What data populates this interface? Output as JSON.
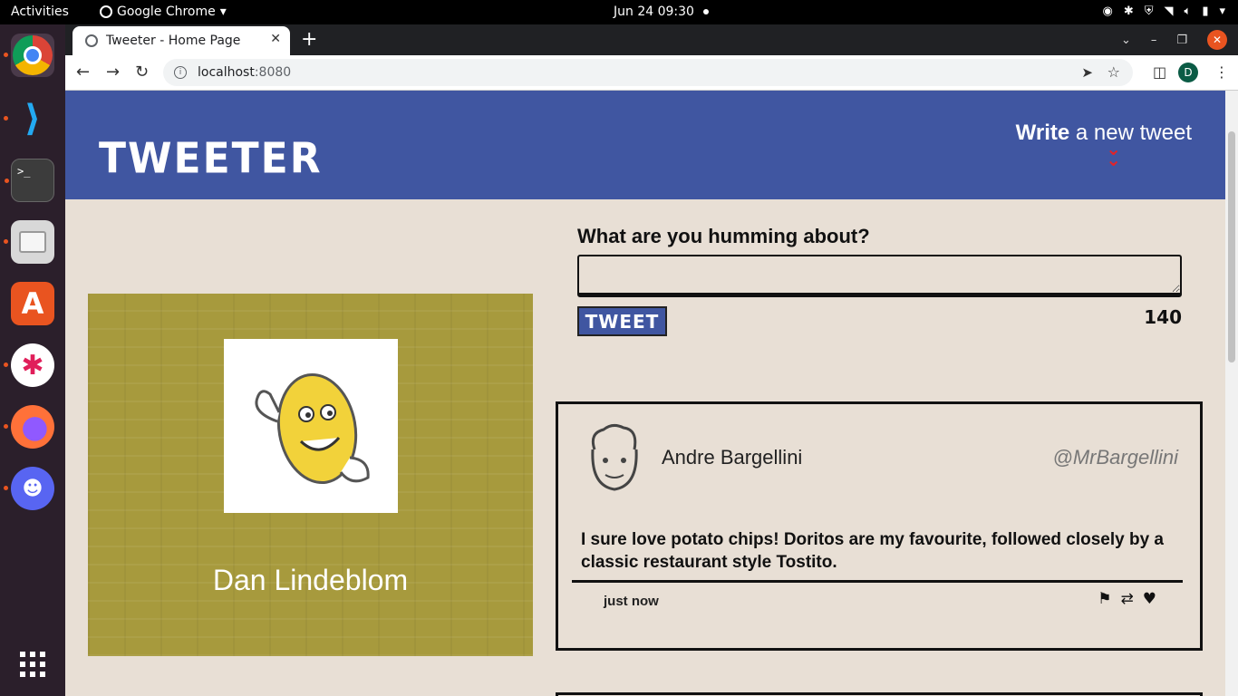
{
  "os": {
    "activities": "Activities",
    "app_name": "Google Chrome",
    "clock": "Jun 24  09:30"
  },
  "browser": {
    "tab_title": "Tweeter - Home Page",
    "url_host": "localhost",
    "url_port": ":8080",
    "profile_initial": "D"
  },
  "nav": {
    "logo": "Tweeter",
    "write_bold": "Write",
    "write_rest": " a new tweet"
  },
  "profile": {
    "name": "Dan Lindeblom"
  },
  "compose": {
    "label": "What are you humming about?",
    "textarea_value": "",
    "button_label": "Tweet",
    "counter": "140"
  },
  "tweets": [
    {
      "name": "Andre Bargellini",
      "handle": "@MrBargellini",
      "text": "I sure love potato chips! Doritos are my favourite, followed closely by a classic restaurant style Tostito.",
      "time": "just now"
    }
  ],
  "colors": {
    "nav_bg": "#4056a1",
    "page_bg": "#e8dfd5",
    "profile_bg": "#a79a3d",
    "chevron": "#e0242a"
  },
  "icons": {
    "tweet_actions": [
      "flag-icon",
      "retweet-icon",
      "heart-icon"
    ]
  }
}
